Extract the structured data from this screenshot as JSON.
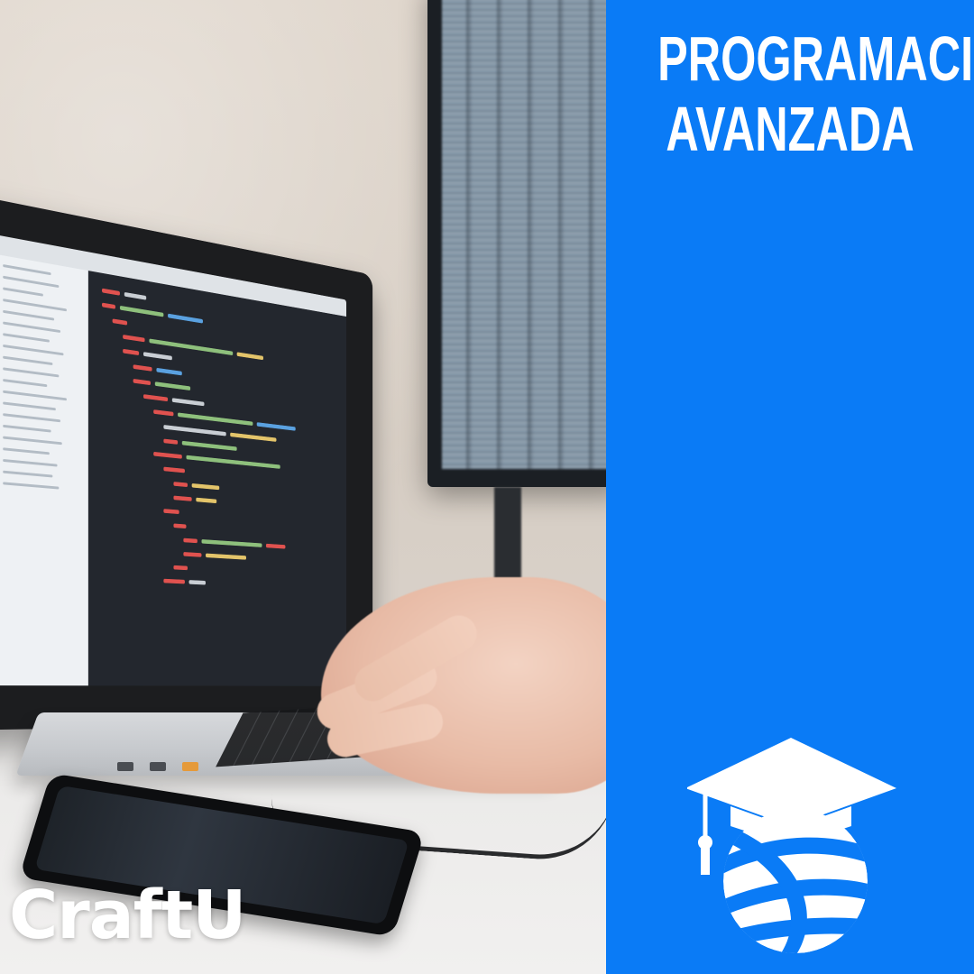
{
  "brand": {
    "name": "CraftU"
  },
  "course": {
    "title_line1": "PROGRAMACION",
    "title_line2": "AVANZADA"
  },
  "colors": {
    "panel_blue": "#0a7bf6",
    "text_white": "#ffffff"
  },
  "icons": {
    "logo": "graduation-cap-globe-icon"
  }
}
